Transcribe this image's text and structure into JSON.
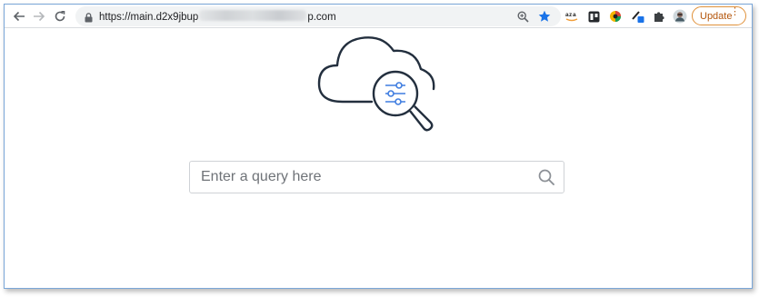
{
  "browser": {
    "url_prefix": "https://main.d2x9jbup",
    "url_suffix": "p.com",
    "update_label": "Update",
    "menu_glyph": "⋮",
    "extensions": [
      "amazon-icon",
      "trello-icon",
      "colorful-ball-icon",
      "pen-tool-icon",
      "puzzle-icon",
      "profile-avatar"
    ]
  },
  "search": {
    "placeholder": "Enter a query here"
  },
  "colors": {
    "accent_blue": "#1a73e8",
    "illustration_stroke": "#232f3e",
    "filter_blue": "#3f7de0",
    "update_orange": "#e0913a"
  }
}
